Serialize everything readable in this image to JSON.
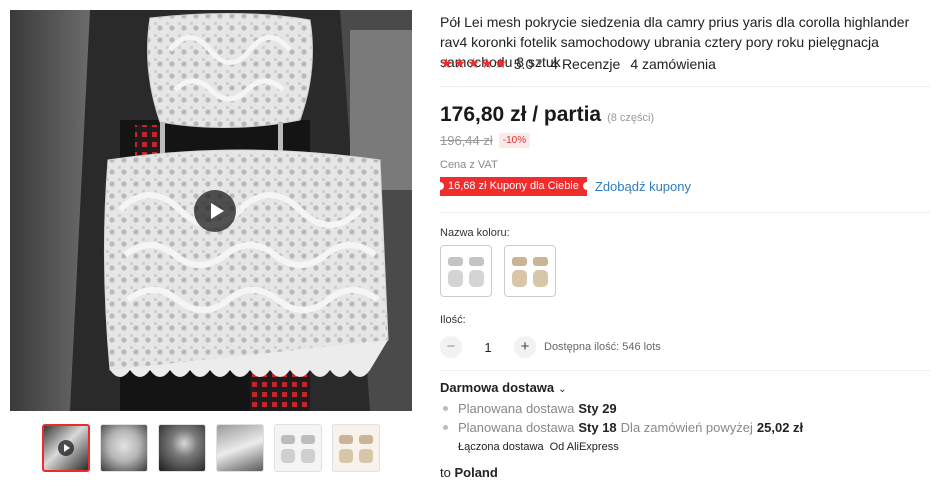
{
  "product": {
    "title": "Pół Lei mesh pokrycie siedzenia dla camry prius yaris dla corolla highlander rav4 koronki fotelik samochodowy ubrania cztery pory roku pielęgnacja samochodu 8 sztuk",
    "rating": {
      "stars": 5,
      "star_glyphs": "★★★★★",
      "score": "5.0",
      "reviews": "4 Recenzje",
      "orders": "4 zamówienia"
    },
    "price": "176,80 zł / partia",
    "price_unit": "(8 części)",
    "old_price": "196,44 zł",
    "discount": "-10%",
    "vat": "Cena z VAT",
    "coupon": "16,68 zł Kupony dla Ciebie",
    "coupon_link": "Zdobądź kupony"
  },
  "gallery": {
    "thumbnail_count": 6,
    "active_thumbnail": 0,
    "play_icon": "play-icon"
  },
  "options": {
    "color_label": "Nazwa koloru:",
    "colors": [
      {
        "name": "grey",
        "hex": "#bfbfbf"
      },
      {
        "name": "beige",
        "hex": "#cdb89a"
      }
    ],
    "quantity_label": "Ilość:",
    "quantity": "1",
    "minus": "−",
    "plus": "+",
    "stock": "Dostępna ilość: 546 lots"
  },
  "shipping": {
    "title": "Darmowa dostawa",
    "line1_label": "Planowana dostawa",
    "line1_date": "Sty 29",
    "line2_label": "Planowana dostawa",
    "line2_date": "Sty 18",
    "line2_condition": "Dla zamówień powyżej",
    "line2_amount": "25,02 zł",
    "combined_label": "Łączona dostawa",
    "combined_from": "Od AliExpress",
    "dest_prefix": "to",
    "dest_country": "Poland"
  },
  "colors": {
    "accent": "#f12c2c",
    "link": "#2f7dbd",
    "star": "#f12c2c"
  }
}
